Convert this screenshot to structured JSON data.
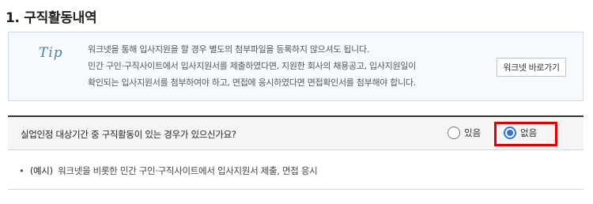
{
  "section": {
    "title": "1. 구직활동내역"
  },
  "tip": {
    "label": "Tip",
    "lines": [
      "워크넷을 통해 입사지원을 할 경우 별도의 첨부파일을 등록하지 않으셔도 됩니다.",
      "민간 구인·구직사이트에서 입사지원서를 제출하였다면, 지원한 회사의 채용공고, 입사지원일이",
      "확인되는 입사지원서를 첨부하여야 하고, 면접에 응시하였다면 면접확인서를 첨부해야 합니다."
    ],
    "button_label": "워크넷 바로가기"
  },
  "question": {
    "text": "실업인정 대상기간 중 구직활동이 있는 경우가 있으신가요?",
    "options": [
      {
        "label": "있음",
        "selected": false
      },
      {
        "label": "없음",
        "selected": true
      }
    ],
    "highlight_color": "#e00000"
  },
  "example": {
    "bullet": "•",
    "prefix": "(예시)",
    "text": "워크넷을 비롯한 민간 구인·구직사이트에서 입사지원서 제출, 면접 응시"
  },
  "colors": {
    "accent": "#2f74d8",
    "tip_label": "#4a7fb8",
    "tip_border": "#c9dcec"
  }
}
